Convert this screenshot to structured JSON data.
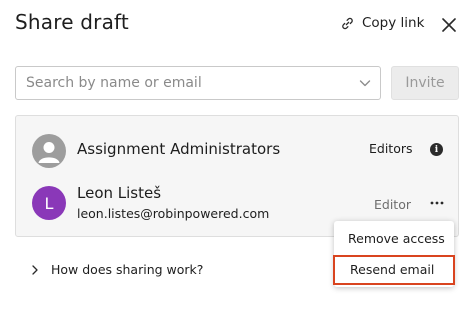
{
  "dialog": {
    "title": "Share draft",
    "copy_link_label": "Copy link"
  },
  "search": {
    "placeholder": "Search by name or email",
    "value": ""
  },
  "invite_label": "Invite",
  "members": [
    {
      "name": "Assignment Administrators",
      "role": "Editors",
      "avatar": "group-avatar"
    },
    {
      "name": "Leon Listeš",
      "email": "leon.listes@robinpowered.com",
      "role": "Editor",
      "avatar_letter": "L",
      "avatar_color": "#8a38b8"
    }
  ],
  "menu": {
    "items": [
      "Remove access",
      "Resend email"
    ],
    "highlight_color": "#d9441f"
  },
  "footer": {
    "how_sharing_label": "How does sharing work?"
  }
}
